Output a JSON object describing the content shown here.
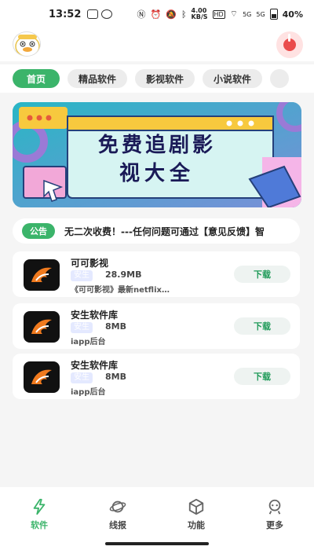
{
  "status_bar": {
    "time": "13:52",
    "speed": "4.00",
    "speed_unit": "KB/S",
    "hd": "HD",
    "net1": "5G",
    "net2": "5G",
    "battery": "40%"
  },
  "tabs": [
    {
      "label": "首页",
      "active": true
    },
    {
      "label": "精品软件",
      "active": false
    },
    {
      "label": "影视软件",
      "active": false
    },
    {
      "label": "小说软件",
      "active": false
    }
  ],
  "banner": {
    "line1": "免费追剧影",
    "line2": "视大全"
  },
  "notice": {
    "badge": "公告",
    "text": "无二次收费！---任何问题可通过【意见反馈】智"
  },
  "apps": [
    {
      "name": "可可影视",
      "tag": "安生",
      "size": "28.9MB",
      "desc": "《可可影视》最新netflix…",
      "action": "下载"
    },
    {
      "name": "安生软件库",
      "tag": "安生",
      "size": "8MB",
      "desc": "iapp后台",
      "action": "下载"
    },
    {
      "name": "安生软件库",
      "tag": "安生",
      "size": "8MB",
      "desc": "iapp后台",
      "action": "下载"
    }
  ],
  "bottom_nav": [
    {
      "label": "软件",
      "icon": "lightning-icon",
      "active": true
    },
    {
      "label": "线报",
      "icon": "planet-icon",
      "active": false
    },
    {
      "label": "功能",
      "icon": "cube-icon",
      "active": false
    },
    {
      "label": "更多",
      "icon": "robot-icon",
      "active": false
    }
  ],
  "colors": {
    "accent": "#3bb46a",
    "download_text": "#1e9a58",
    "music_red": "#ea4b4b"
  }
}
